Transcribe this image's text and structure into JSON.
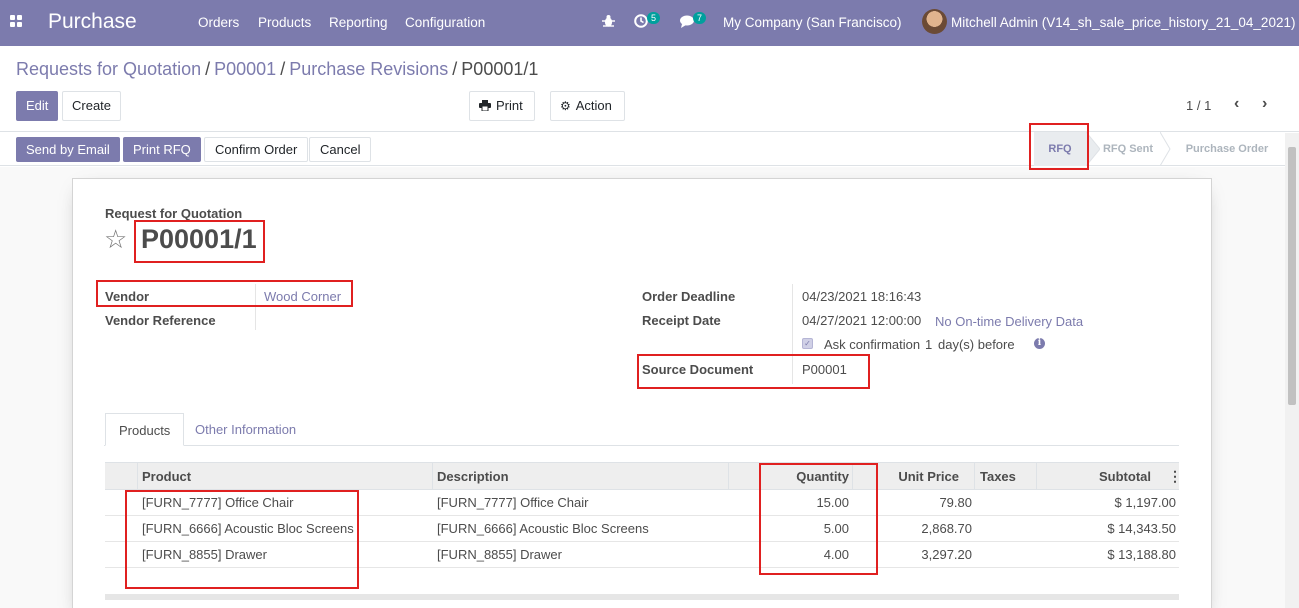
{
  "navbar": {
    "app_name": "Purchase",
    "menus": [
      "Orders",
      "Products",
      "Reporting",
      "Configuration"
    ],
    "activity_count": "5",
    "message_count": "7",
    "company": "My Company (San Francisco)",
    "user": "Mitchell Admin (V14_sh_sale_price_history_21_04_2021)"
  },
  "breadcrumb": {
    "items": [
      "Requests for Quotation",
      "P00001",
      "Purchase Revisions"
    ],
    "current": "P00001/1",
    "separator": "/"
  },
  "toolbar": {
    "edit_label": "Edit",
    "create_label": "Create",
    "print_label": "Print",
    "action_label": "Action"
  },
  "pager": {
    "value": "1 / 1"
  },
  "statusbar": {
    "buttons": [
      "Send by Email",
      "Print RFQ",
      "Confirm Order",
      "Cancel"
    ],
    "stages": [
      "RFQ",
      "RFQ Sent",
      "Purchase Order"
    ],
    "current_stage": "RFQ"
  },
  "form": {
    "doc_type": "Request for Quotation",
    "name": "P00001/1",
    "vendor_label": "Vendor",
    "vendor_value": "Wood Corner",
    "vendor_ref_label": "Vendor Reference",
    "vendor_ref_value": "",
    "order_deadline_label": "Order Deadline",
    "order_deadline_value": "04/23/2021 18:16:43",
    "receipt_date_label": "Receipt Date",
    "receipt_date_value": "04/27/2021 12:00:00",
    "on_time_link": "No On-time Delivery Data",
    "ask_confirmation_text": "Ask confirmation",
    "ask_confirmation_days": "1",
    "ask_confirmation_suffix": "day(s) before",
    "ask_confirmation_checked": true,
    "source_doc_label": "Source Document",
    "source_doc_value": "P00001"
  },
  "tabs": [
    "Products",
    "Other Information"
  ],
  "lines_table": {
    "headers": [
      "Product",
      "Description",
      "Quantity",
      "Unit Price",
      "Taxes",
      "Subtotal"
    ],
    "rows": [
      {
        "product": "[FURN_7777] Office Chair",
        "description": "[FURN_7777] Office Chair",
        "quantity": "15.00",
        "unit_price": "79.80",
        "taxes": "",
        "subtotal": "$ 1,197.00"
      },
      {
        "product": "[FURN_6666] Acoustic Bloc Screens",
        "description": "[FURN_6666] Acoustic Bloc Screens",
        "quantity": "5.00",
        "unit_price": "2,868.70",
        "taxes": "",
        "subtotal": "$ 14,343.50"
      },
      {
        "product": "[FURN_8855] Drawer",
        "description": "[FURN_8855] Drawer",
        "quantity": "4.00",
        "unit_price": "3,297.20",
        "taxes": "",
        "subtotal": "$ 13,188.80"
      }
    ]
  },
  "colors": {
    "brand": "#7c7bad",
    "highlight": "#e02020",
    "badge": "#00a09d"
  },
  "icons": {
    "apps": "apps-grid-icon",
    "debug": "bug-icon",
    "activity": "clock-icon",
    "messages": "chat-icon",
    "print": "printer-icon",
    "action": "gear-icon",
    "favorite": "star-icon",
    "info": "info-icon"
  }
}
